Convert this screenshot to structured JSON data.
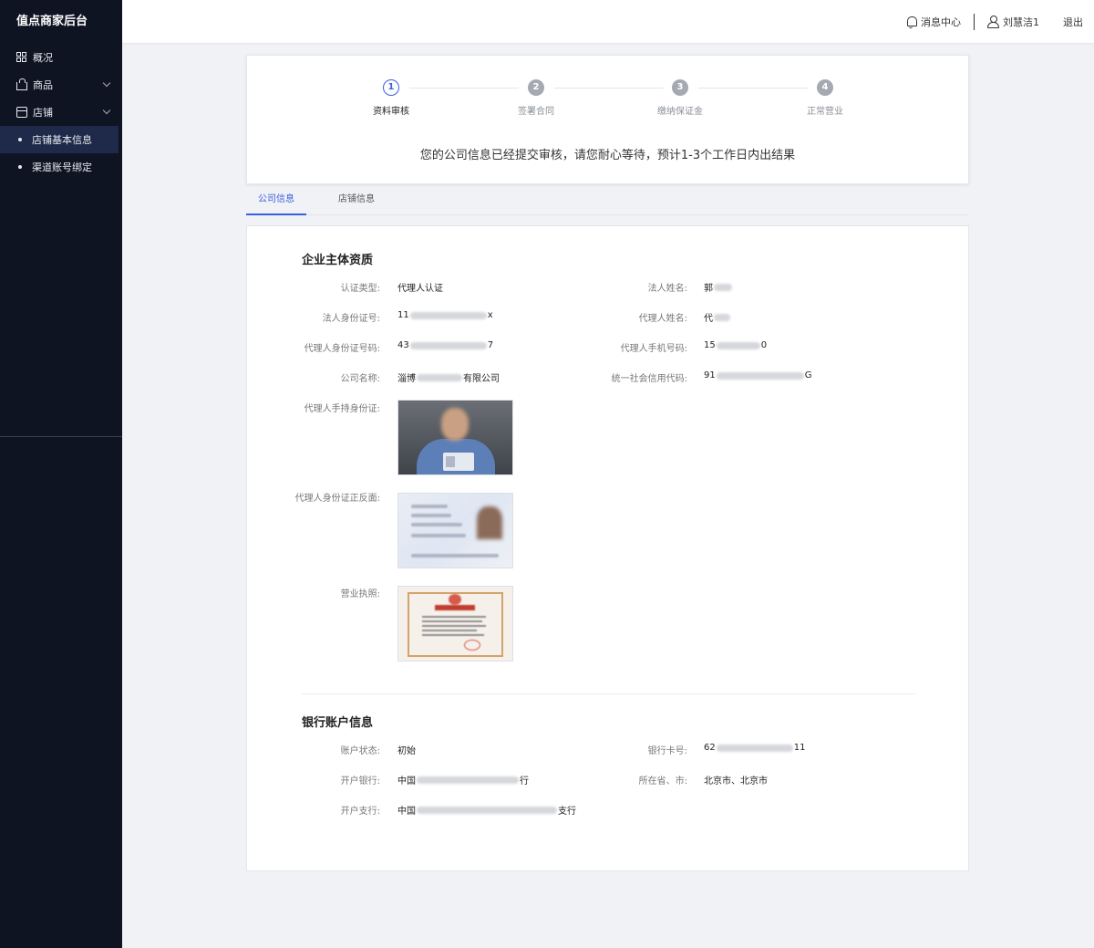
{
  "brand": "值点商家后台",
  "nav": {
    "overview": "概况",
    "goods": "商品",
    "shop": "店铺",
    "sub_items": [
      {
        "label": "店铺基本信息",
        "active": true
      },
      {
        "label": "渠道账号绑定",
        "active": false
      }
    ]
  },
  "header": {
    "messages": "消息中心",
    "user": "刘慧洁1",
    "logout": "退出"
  },
  "steps": [
    {
      "num": "1",
      "label": "资料审核",
      "state": "active"
    },
    {
      "num": "2",
      "label": "签署合同",
      "state": "pending"
    },
    {
      "num": "3",
      "label": "缴纳保证金",
      "state": "pending"
    },
    {
      "num": "4",
      "label": "正常营业",
      "state": "pending"
    }
  ],
  "notice": "您的公司信息已经提交审核，请您耐心等待，预计1-3个工作日内出结果",
  "tabs": [
    {
      "label": "公司信息",
      "active": true
    },
    {
      "label": "店铺信息",
      "active": false
    }
  ],
  "company": {
    "title": "企业主体资质",
    "auth_type_label": "认证类型:",
    "auth_type": "代理人认证",
    "legal_name_label": "法人姓名:",
    "legal_name_prefix": "郭",
    "legal_id_label": "法人身份证号:",
    "legal_id_prefix": "11",
    "legal_id_suffix": "x",
    "agent_name_label": "代理人姓名:",
    "agent_name_prefix": "代",
    "agent_id_label": "代理人身份证号码:",
    "agent_id_prefix": "43",
    "agent_id_suffix": "7",
    "agent_phone_label": "代理人手机号码:",
    "agent_phone_prefix": "15",
    "agent_phone_suffix": "0",
    "company_name_label": "公司名称:",
    "company_name_prefix": "淄博",
    "company_name_suffix": "有限公司",
    "credit_code_label": "统一社会信用代码:",
    "credit_code_prefix": "91",
    "credit_code_suffix": "G",
    "hold_id_label": "代理人手持身份证:",
    "id_front_back_label": "代理人身份证正反面:",
    "license_label": "营业执照:"
  },
  "bank": {
    "title": "银行账户信息",
    "status_label": "账户状态:",
    "status": "初始",
    "card_label": "银行卡号:",
    "card_prefix": "62",
    "card_suffix": "11",
    "bank_label": "开户银行:",
    "bank_prefix": "中国",
    "bank_suffix": "行",
    "region_label": "所在省、市:",
    "region": "北京市、北京市",
    "branch_label": "开户支行:",
    "branch_prefix": "中国",
    "branch_suffix": "支行"
  },
  "colors": {
    "sidebar_bg": "#0f1423",
    "accent": "#3a5ee0",
    "page_bg": "#f0f2f5"
  }
}
